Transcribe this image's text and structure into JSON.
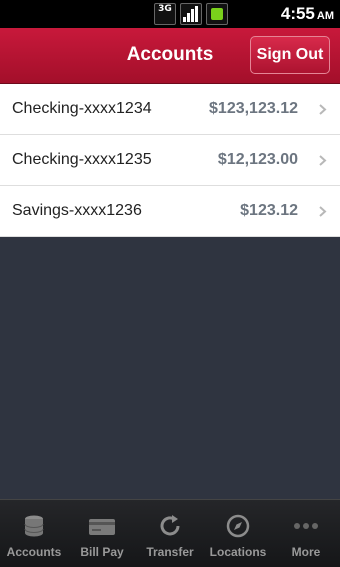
{
  "status": {
    "network_label": "3G",
    "time": "4:55",
    "ampm": "AM"
  },
  "header": {
    "title": "Accounts",
    "sign_out_label": "Sign Out"
  },
  "accounts": [
    {
      "name": "Checking-xxxx1234",
      "balance": "$123,123.12"
    },
    {
      "name": "Checking-xxxx1235",
      "balance": "$12,123.00"
    },
    {
      "name": "Savings-xxxx1236",
      "balance": "$123.12"
    }
  ],
  "tabs": [
    {
      "label": "Accounts",
      "icon": "accounts-icon"
    },
    {
      "label": "Bill Pay",
      "icon": "bill-pay-icon"
    },
    {
      "label": "Transfer",
      "icon": "transfer-icon"
    },
    {
      "label": "Locations",
      "icon": "locations-icon"
    },
    {
      "label": "More",
      "icon": "more-icon"
    }
  ],
  "colors": {
    "header_red": "#b8122f",
    "background": "#2f3440",
    "tab_bar": "#1b1c1f"
  }
}
